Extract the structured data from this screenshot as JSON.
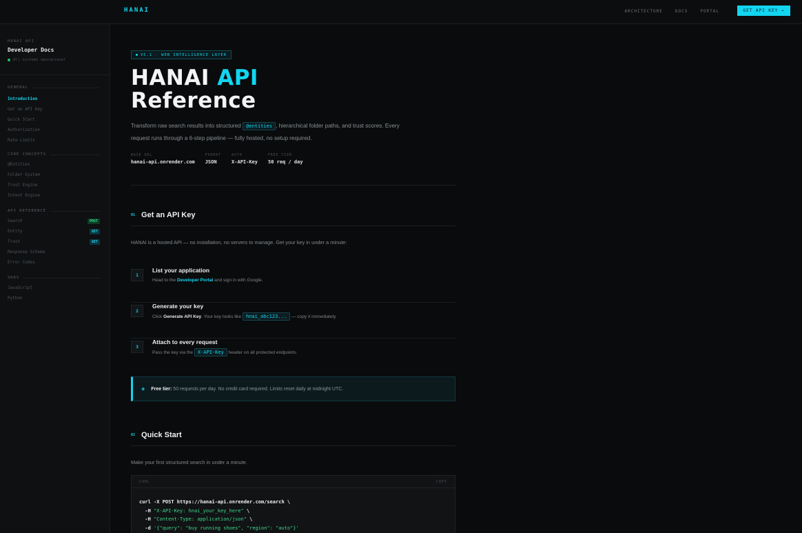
{
  "topnav": {
    "brand": "HANAI",
    "links": [
      "ARCHITECTURE",
      "DOCS",
      "PORTAL"
    ],
    "cta": "GET API KEY →"
  },
  "sidebar": {
    "eyebrow": "HANAI API",
    "title": "Developer Docs",
    "status": "All systems operational",
    "sections": [
      {
        "label": "GENERAL",
        "items": [
          {
            "label": "Introduction",
            "active": true
          },
          {
            "label": "Get an API Key"
          },
          {
            "label": "Quick Start"
          },
          {
            "label": "Authorization"
          },
          {
            "label": "Rate Limits"
          }
        ]
      },
      {
        "label": "CORE CONCEPTS",
        "items": [
          {
            "label": "@Entities"
          },
          {
            "label": "Folder System"
          },
          {
            "label": "Trust Engine"
          },
          {
            "label": "Intent Engine"
          }
        ]
      },
      {
        "label": "API REFERENCE",
        "items": [
          {
            "label": "Search",
            "badge": "POST"
          },
          {
            "label": "Entity",
            "badge": "GET"
          },
          {
            "label": "Trust",
            "badge": "GET"
          },
          {
            "label": "Response Schema"
          },
          {
            "label": "Error Codes"
          }
        ]
      },
      {
        "label": "SDKS",
        "items": [
          {
            "label": "JavaScript"
          },
          {
            "label": "Python"
          }
        ]
      }
    ]
  },
  "hero": {
    "pill": "V5.1 · WEB INTELLIGENCE LAYER",
    "title_part1": "HANAI ",
    "title_accent": "API",
    "title_line2": "Reference",
    "lead_before": "Transform raw search results into structured ",
    "lead_chip": "@entities",
    "lead_after": ", hierarchical folder paths, and trust scores. Every request runs through a 6-step pipeline — fully hosted, no setup required.",
    "meta": [
      {
        "label": "BASE URL",
        "value": "hanai-api.onrender.com"
      },
      {
        "label": "FORMAT",
        "value": "JSON"
      },
      {
        "label": "AUTH",
        "value": "X-API-Key"
      },
      {
        "label": "FREE TIER",
        "value": "50 req / day"
      }
    ]
  },
  "section1": {
    "num": "01",
    "title": "Get an API Key",
    "intro": "HANAI is a hosted API — no installation, no servers to manage. Get your key in under a minute:",
    "steps": [
      {
        "num": "1",
        "title": "List your application",
        "desc_before": "Head to the ",
        "link": "Developer Portal",
        "desc_after": " and sign in with Google."
      },
      {
        "num": "2",
        "title": "Generate your key",
        "desc_before": "Click ",
        "bold": "Generate API Key",
        "desc_mid": ". Your key looks like ",
        "chip": "hnai_abc123...",
        "desc_after": " — copy it immediately."
      },
      {
        "num": "3",
        "title": "Attach to every request",
        "desc_before": "Pass the key via the ",
        "chip": "X-API-Key",
        "desc_after": " header on all protected endpoints."
      }
    ],
    "callout_icon": "◈",
    "callout_bold": "Free tier:",
    "callout_text": " 50 requests per day. No credit card required. Limits reset daily at midnight UTC."
  },
  "section2": {
    "num": "02",
    "title": "Quick Start",
    "intro": "Make your first structured search in under a minute.",
    "code": {
      "lang": "CURL",
      "copy": "COPY",
      "line1": "curl -X POST https://hanai-api.onrender.com/search \\",
      "line2_flag": "  -H ",
      "line2_str": "\"X-API-Key: hnai_your_key_here\"",
      "line2_end": " \\",
      "line3_flag": "  -H ",
      "line3_str": "\"Content-Type: application/json\"",
      "line3_end": " \\",
      "line4_flag": "  -d ",
      "line4_str": "'{\"query\": \"buy running shoes\", \"region\": \"auto\"}'"
    }
  },
  "colors": {
    "accent": "#12d6f0",
    "background": "#0a0b0c",
    "sidebar": "#0e1012",
    "post": "#37e08b"
  }
}
